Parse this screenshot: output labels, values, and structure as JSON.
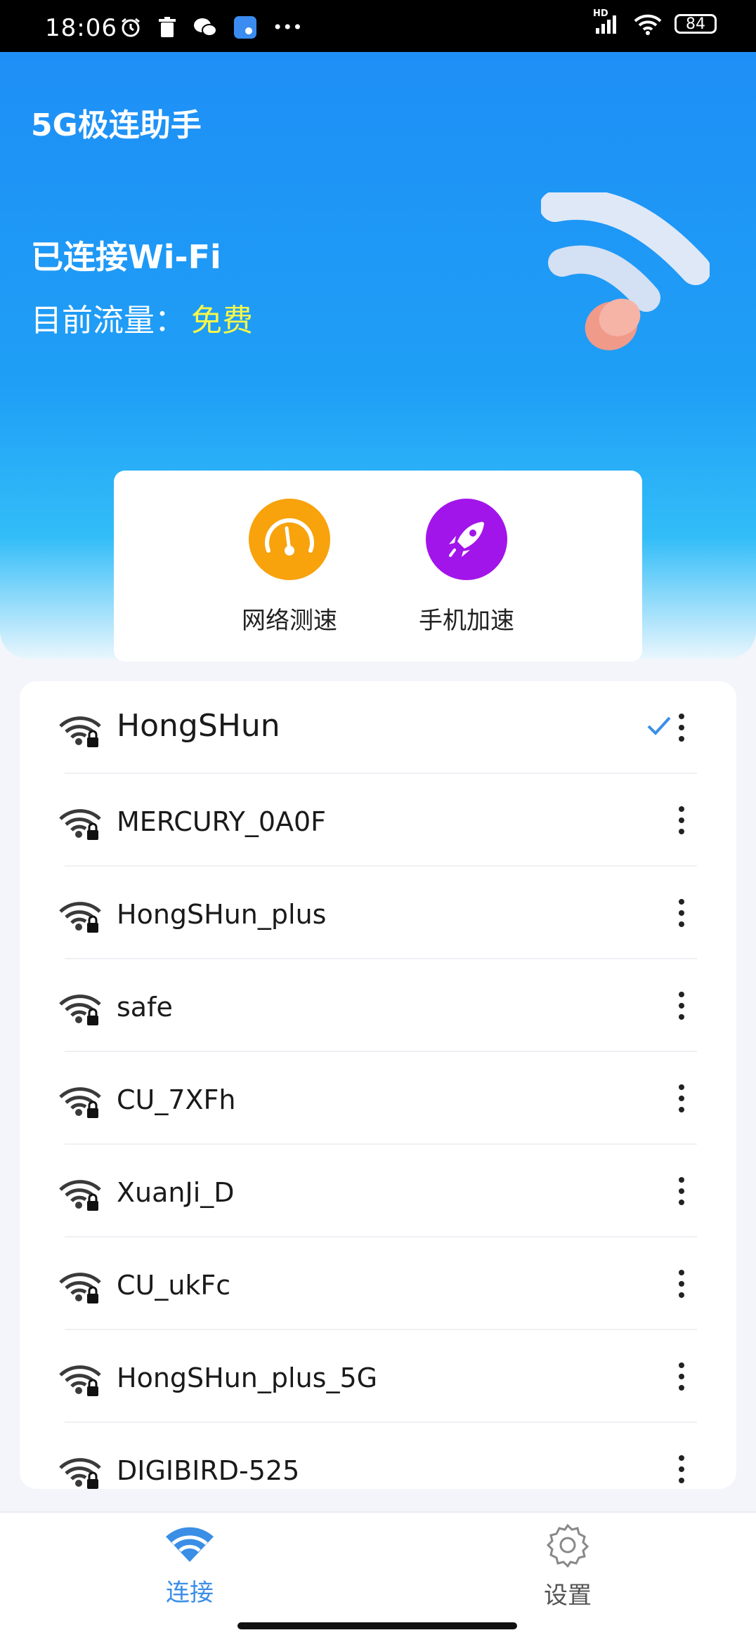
{
  "status_bar": {
    "time": "18:06",
    "network_badge": "HD",
    "battery": "84",
    "more": "•••"
  },
  "header": {
    "app_title": "5G极连助手",
    "connection_status": "已连接Wi-Fi",
    "traffic_label": "目前流量：",
    "traffic_value": "免费",
    "colors": {
      "gradient_top": "#1e8ff6",
      "gradient_bottom": "#32bdf8",
      "free_text": "#f6f84a"
    }
  },
  "tools": [
    {
      "label": "网络测速",
      "icon": "speedometer-icon",
      "color": "#f8a20c"
    },
    {
      "label": "手机加速",
      "icon": "rocket-icon",
      "color": "#a215ea"
    }
  ],
  "networks": [
    {
      "ssid": "HongSHun",
      "connected": true
    },
    {
      "ssid": "MERCURY_0A0F",
      "connected": false
    },
    {
      "ssid": "HongSHun_plus",
      "connected": false
    },
    {
      "ssid": "safe",
      "connected": false
    },
    {
      "ssid": "CU_7XFh",
      "connected": false
    },
    {
      "ssid": "XuanJi_D",
      "connected": false
    },
    {
      "ssid": "CU_ukFc",
      "connected": false
    },
    {
      "ssid": "HongSHun_plus_5G",
      "connected": false
    },
    {
      "ssid": "DIGIBIRD-525",
      "connected": false
    }
  ],
  "bottom_nav": {
    "items": [
      {
        "label": "连接",
        "icon": "wifi-icon",
        "active": true
      },
      {
        "label": "设置",
        "icon": "gear-icon",
        "active": false
      }
    ],
    "active_color": "#3a8ee6",
    "inactive_color": "#555555"
  }
}
